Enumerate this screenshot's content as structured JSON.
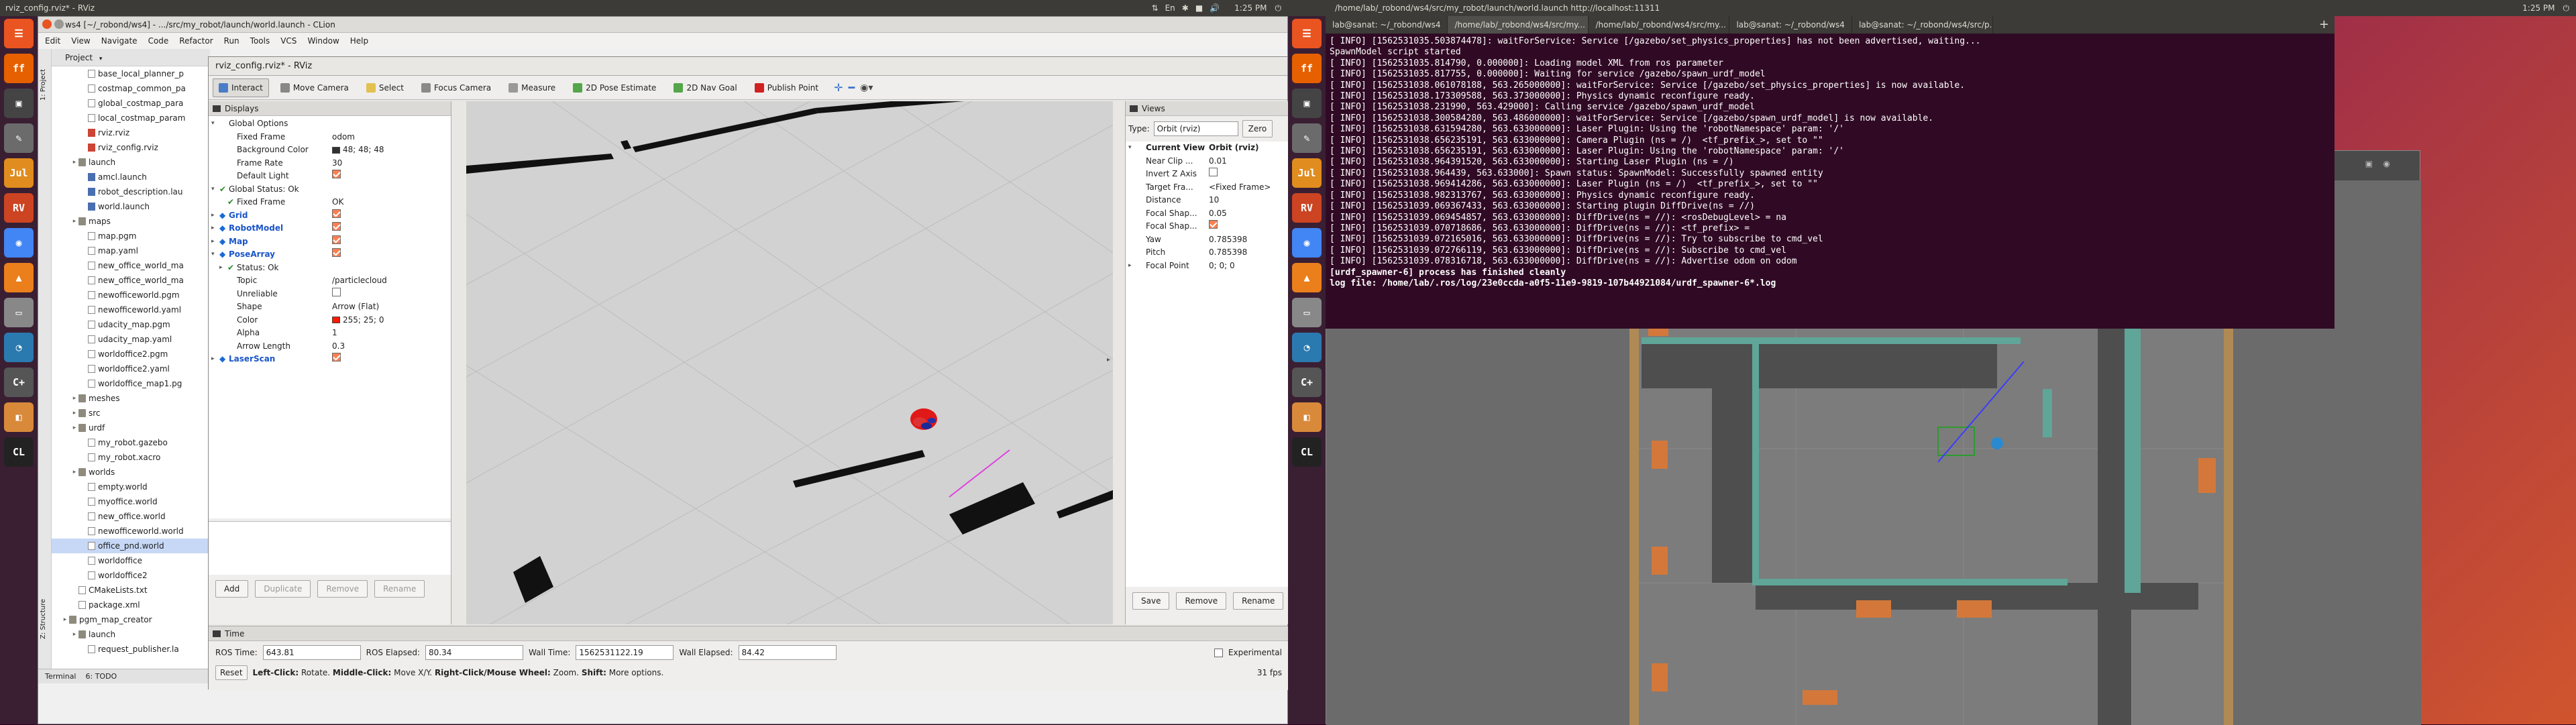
{
  "left_screen": {
    "topbar": {
      "title": "rviz_config.rviz* - RViz",
      "time": "1:25 PM",
      "status": [
        "⇅",
        "En",
        "✱",
        "■",
        "🔊"
      ]
    },
    "clion": {
      "title": "ws4 [~/_robond/ws4] - .../src/my_robot/launch/world.launch - CLion",
      "menu": [
        "Edit",
        "View",
        "Navigate",
        "Code",
        "Refactor",
        "Run",
        "Tools",
        "VCS",
        "Window",
        "Help"
      ],
      "project_label": "Project",
      "tree": [
        {
          "t": "base_local_planner_p",
          "d": 3,
          "k": "file"
        },
        {
          "t": "costmap_common_pa",
          "d": 3,
          "k": "file"
        },
        {
          "t": "global_costmap_para",
          "d": 3,
          "k": "file"
        },
        {
          "t": "local_costmap_param",
          "d": 3,
          "k": "file"
        },
        {
          "t": "rviz.rviz",
          "d": 3,
          "k": "rviz"
        },
        {
          "t": "rviz_config.rviz",
          "d": 3,
          "k": "rviz"
        },
        {
          "t": "launch",
          "d": 2,
          "k": "folder"
        },
        {
          "t": "amcl.launch",
          "d": 3,
          "k": "ros"
        },
        {
          "t": "robot_description.lau",
          "d": 3,
          "k": "ros"
        },
        {
          "t": "world.launch",
          "d": 3,
          "k": "ros"
        },
        {
          "t": "maps",
          "d": 2,
          "k": "folder"
        },
        {
          "t": "map.pgm",
          "d": 3,
          "k": "file"
        },
        {
          "t": "map.yaml",
          "d": 3,
          "k": "file"
        },
        {
          "t": "new_office_world_ma",
          "d": 3,
          "k": "file"
        },
        {
          "t": "new_office_world_ma",
          "d": 3,
          "k": "file"
        },
        {
          "t": "newofficeworld.pgm",
          "d": 3,
          "k": "file"
        },
        {
          "t": "newofficeworld.yaml",
          "d": 3,
          "k": "file"
        },
        {
          "t": "udacity_map.pgm",
          "d": 3,
          "k": "file"
        },
        {
          "t": "udacity_map.yaml",
          "d": 3,
          "k": "file"
        },
        {
          "t": "worldoffice2.pgm",
          "d": 3,
          "k": "file"
        },
        {
          "t": "worldoffice2.yaml",
          "d": 3,
          "k": "file"
        },
        {
          "t": "worldoffice_map1.pg",
          "d": 3,
          "k": "file"
        },
        {
          "t": "meshes",
          "d": 2,
          "k": "folder"
        },
        {
          "t": "src",
          "d": 2,
          "k": "folder"
        },
        {
          "t": "urdf",
          "d": 2,
          "k": "folder"
        },
        {
          "t": "my_robot.gazebo",
          "d": 3,
          "k": "file"
        },
        {
          "t": "my_robot.xacro",
          "d": 3,
          "k": "file"
        },
        {
          "t": "worlds",
          "d": 2,
          "k": "folder"
        },
        {
          "t": "empty.world",
          "d": 3,
          "k": "file"
        },
        {
          "t": "myoffice.world",
          "d": 3,
          "k": "file"
        },
        {
          "t": "new_office.world",
          "d": 3,
          "k": "file"
        },
        {
          "t": "newofficeworld.world",
          "d": 3,
          "k": "file"
        },
        {
          "t": "office_pnd.world",
          "d": 3,
          "k": "file",
          "sel": true
        },
        {
          "t": "worldoffice",
          "d": 3,
          "k": "file"
        },
        {
          "t": "worldoffice2",
          "d": 3,
          "k": "file"
        },
        {
          "t": "CMakeLists.txt",
          "d": 2,
          "k": "file"
        },
        {
          "t": "package.xml",
          "d": 2,
          "k": "file"
        },
        {
          "t": "pgm_map_creator",
          "d": 1,
          "k": "folder"
        },
        {
          "t": "launch",
          "d": 2,
          "k": "folder"
        },
        {
          "t": "request_publisher.la",
          "d": 3,
          "k": "file"
        }
      ],
      "bottom_tabs": [
        "Terminal",
        "6: TODO"
      ],
      "side_labels": [
        "1: Project",
        "Z: Structure"
      ]
    },
    "launcher": [
      "☰",
      "ff",
      "▣",
      "✎",
      "Jul",
      "RV",
      "◉",
      "▲",
      "▭",
      "◔",
      "C+",
      "◧",
      "CL"
    ],
    "rviz": {
      "title": "rviz_config.rviz* - RViz",
      "tools": [
        {
          "l": "Interact",
          "c": "#4a7cc7",
          "active": true
        },
        {
          "l": "Move Camera",
          "c": "#888"
        },
        {
          "l": "Select",
          "c": "#e3c150"
        },
        {
          "l": "Focus Camera",
          "c": "#8a8a8a"
        },
        {
          "l": "Measure",
          "c": "#999"
        },
        {
          "l": "2D Pose Estimate",
          "c": "#55a54a"
        },
        {
          "l": "2D Nav Goal",
          "c": "#55a54a"
        },
        {
          "l": "Publish Point",
          "c": "#d02020"
        }
      ],
      "displays": {
        "header": "Displays",
        "rows": [
          {
            "n": "Global Options",
            "v": "",
            "tw": "▾",
            "d": 0
          },
          {
            "n": "Fixed Frame",
            "v": "odom",
            "d": 1
          },
          {
            "n": "Background Color",
            "v": "48; 48; 48",
            "d": 1,
            "sw": "#303030"
          },
          {
            "n": "Frame Rate",
            "v": "30",
            "d": 1
          },
          {
            "n": "Default Light",
            "v": "",
            "d": 1,
            "cb": true
          },
          {
            "n": "Global Status: Ok",
            "v": "",
            "tw": "▾",
            "d": 0,
            "ok": true
          },
          {
            "n": "Fixed Frame",
            "v": "OK",
            "d": 1,
            "ok": true
          },
          {
            "n": "Grid",
            "v": "",
            "tw": "▸",
            "d": 0,
            "blue": true,
            "cb": true
          },
          {
            "n": "RobotModel",
            "v": "",
            "tw": "▸",
            "d": 0,
            "blue": true,
            "cb": true
          },
          {
            "n": "Map",
            "v": "",
            "tw": "▸",
            "d": 0,
            "blue": true,
            "cb": true
          },
          {
            "n": "PoseArray",
            "v": "",
            "tw": "▾",
            "d": 0,
            "blue": true,
            "cb": true
          },
          {
            "n": "Status: Ok",
            "v": "",
            "tw": "▸",
            "d": 1,
            "ok": true
          },
          {
            "n": "Topic",
            "v": "/particlecloud",
            "d": 1
          },
          {
            "n": "Unreliable",
            "v": "",
            "d": 1,
            "cboff": true
          },
          {
            "n": "Shape",
            "v": "Arrow (Flat)",
            "d": 1
          },
          {
            "n": "Color",
            "v": "255; 25; 0",
            "d": 1,
            "sw": "#ff1900"
          },
          {
            "n": "Alpha",
            "v": "1",
            "d": 1
          },
          {
            "n": "Arrow Length",
            "v": "0.3",
            "d": 1
          },
          {
            "n": "LaserScan",
            "v": "",
            "tw": "▸",
            "d": 0,
            "blue": true,
            "cb": true
          }
        ],
        "buttons": [
          "Add",
          "Duplicate",
          "Remove",
          "Rename"
        ]
      },
      "views": {
        "header": "Views",
        "type_label": "Type:",
        "type_value": "Orbit (rviz)",
        "zero": "Zero",
        "rows": [
          {
            "n": "Current View",
            "v": "Orbit (rviz)",
            "tw": "▾",
            "bold": true
          },
          {
            "n": "Near Clip ...",
            "v": "0.01"
          },
          {
            "n": "Invert Z Axis",
            "v": "",
            "cboff": true
          },
          {
            "n": "Target Fra...",
            "v": "<Fixed Frame>"
          },
          {
            "n": "Distance",
            "v": "10"
          },
          {
            "n": "Focal Shap...",
            "v": "0.05"
          },
          {
            "n": "Focal Shap...",
            "v": "",
            "cb": true
          },
          {
            "n": "Yaw",
            "v": "0.785398"
          },
          {
            "n": "Pitch",
            "v": "0.785398"
          },
          {
            "n": "Focal Point",
            "v": "0; 0; 0",
            "tw": "▸"
          }
        ],
        "buttons": [
          "Save",
          "Remove",
          "Rename"
        ]
      },
      "time": {
        "header": "Time",
        "ros_time_label": "ROS Time:",
        "ros_time": "643.81",
        "ros_elapsed_label": "ROS Elapsed:",
        "ros_elapsed": "80.34",
        "wall_time_label": "Wall Time:",
        "wall_time": "1562531122.19",
        "wall_elapsed_label": "Wall Elapsed:",
        "wall_elapsed": "84.42",
        "experimental": "Experimental",
        "reset": "Reset",
        "hint_a": "Left-Click:",
        "hint_b": " Rotate. ",
        "hint_c": "Middle-Click:",
        "hint_d": " Move X/Y. ",
        "hint_e": "Right-Click/Mouse Wheel:",
        "hint_f": " Zoom. ",
        "hint_g": "Shift:",
        "hint_h": " More options.",
        "fps": "31 fps"
      }
    }
  },
  "right_screen": {
    "topbar": {
      "title": "/home/lab/_robond/ws4/src/my_robot/launch/world.launch http://localhost:11311",
      "time": "1:25 PM"
    },
    "launcher": [
      "☰",
      "ff",
      "▣",
      "✎",
      "Jul",
      "RV",
      "◉",
      "▲",
      "▭",
      "◔",
      "C+",
      "◧",
      "CL"
    ],
    "tabs": [
      "lab@sanat: ~/_robond/ws4",
      "/home/lab/_robond/ws4/src/my...",
      "/home/lab/_robond/ws4/src/my...",
      "lab@sanat: ~/_robond/ws4",
      "lab@sanat: ~/_robond/ws4/src/p..."
    ],
    "terminal_lines": [
      "[ INFO] [1562531035.503874478]: waitForService: Service [/gazebo/set_physics_properties] has not been advertised, waiting...",
      "SpawnModel script started",
      "[ INFO] [1562531035.814790, 0.000000]: Loading model XML from ros parameter",
      "[ INFO] [1562531035.817755, 0.000000]: Waiting for service /gazebo/spawn_urdf_model",
      "[ INFO] [1562531038.061078188, 563.265000000]: waitForService: Service [/gazebo/set_physics_properties] is now available.",
      "[ INFO] [1562531038.173309588, 563.373000000]: Physics dynamic reconfigure ready.",
      "[ INFO] [1562531038.231990, 563.429000]: Calling service /gazebo/spawn_urdf_model",
      "[ INFO] [1562531038.300584280, 563.486000000]: waitForService: Service [/gazebo/spawn_urdf_model] is now available.",
      "[ INFO] [1562531038.631594280, 563.633000000]: Laser Plugin: Using the 'robotNamespace' param: '/'",
      "[ INFO] [1562531038.656235191, 563.633000000]: Camera Plugin (ns = /)  <tf_prefix_>, set to \"\"",
      "[ INFO] [1562531038.656235191, 563.633000000]: Laser Plugin: Using the 'robotNamespace' param: '/'",
      "[ INFO] [1562531038.964391520, 563.633000000]: Starting Laser Plugin (ns = /)",
      "[ INFO] [1562531038.964439, 563.633000]: Spawn status: SpawnModel: Successfully spawned entity",
      "[ INFO] [1562531038.969414286, 563.633000000]: Laser Plugin (ns = /)  <tf_prefix_>, set to \"\"",
      "[ INFO] [1562531038.982313767, 563.633000000]: Physics dynamic reconfigure ready.",
      "[ INFO] [1562531039.069367433, 563.633000000]: Starting plugin DiffDrive(ns = //)",
      "[ INFO] [1562531039.069454857, 563.633000000]: DiffDrive(ns = //): <rosDebugLevel> = na",
      "[ INFO] [1562531039.070718686, 563.633000000]: DiffDrive(ns = //): <tf_prefix> = ",
      "[ INFO] [1562531039.072165016, 563.633000000]: DiffDrive(ns = //): Try to subscribe to cmd_vel",
      "[ INFO] [1562531039.072766119, 563.633000000]: DiffDrive(ns = //): Subscribe to cmd_vel",
      "[ INFO] [1562531039.078316718, 563.633000000]: DiffDrive(ns = //): Advertise odom on odom",
      "[urdf_spawner-6] process has finished cleanly",
      "log file: /home/lab/.ros/log/23e0ccda-a0f5-11e9-9819-107b44921084/urdf_spawner-6*.log"
    ]
  }
}
